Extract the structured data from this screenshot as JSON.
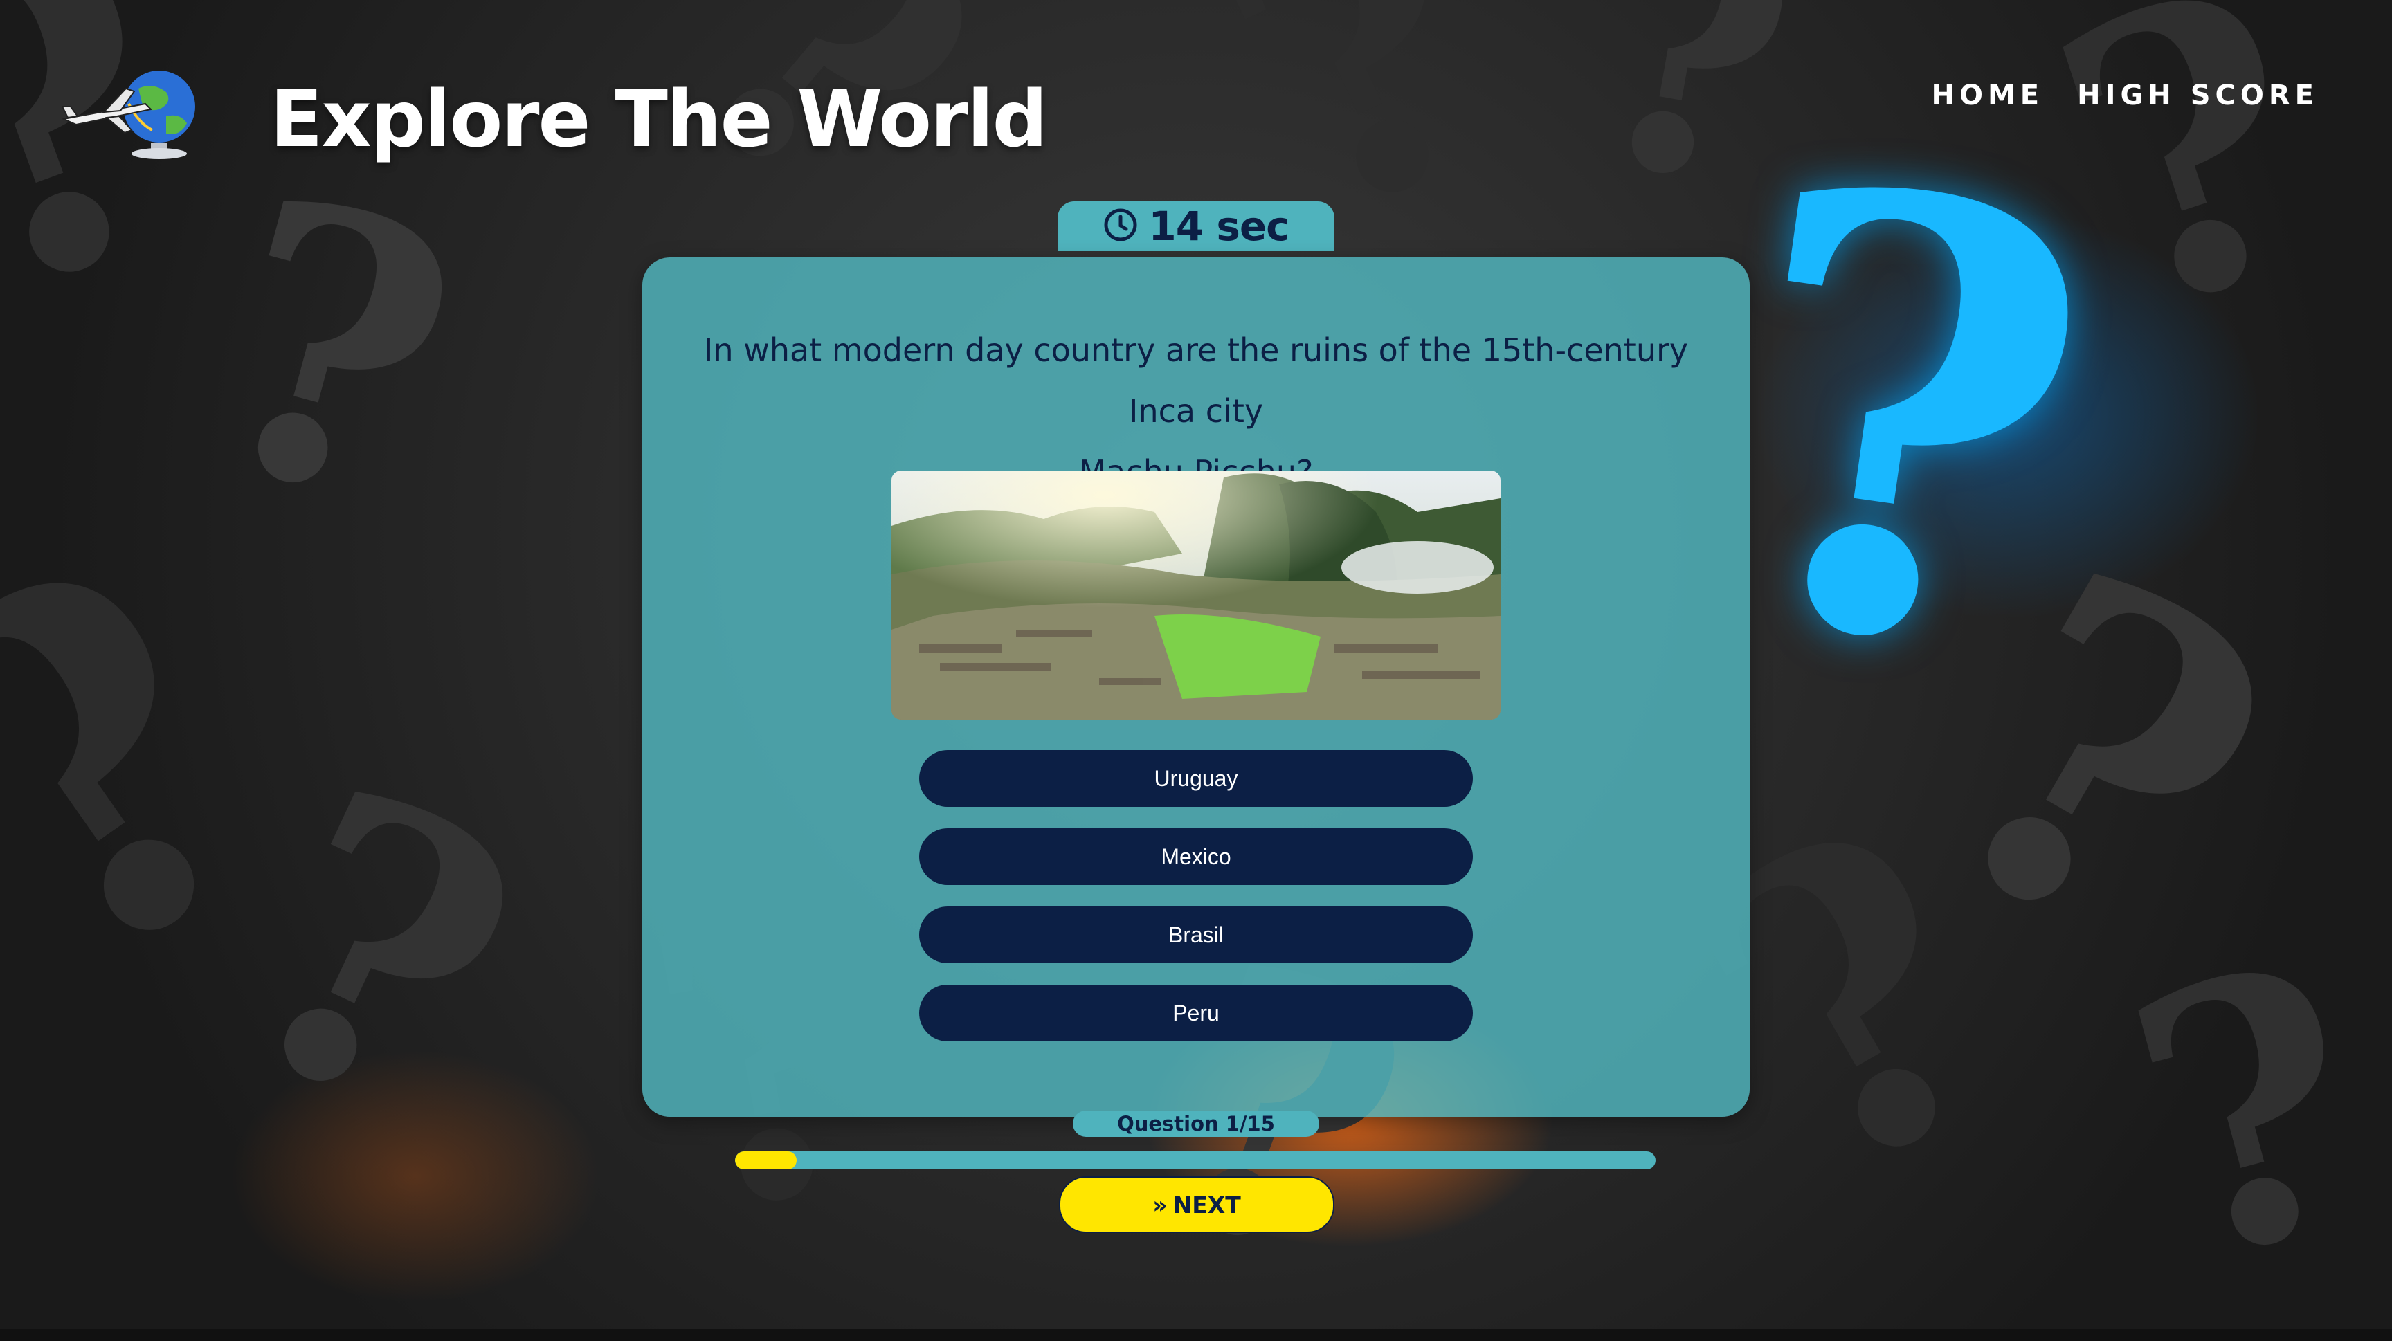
{
  "header": {
    "title": "Explore The World",
    "logo_icon": "globe-airplane-icon"
  },
  "nav": {
    "home": "HOME",
    "high_score": "HIGH SCORE"
  },
  "timer": {
    "icon": "clock-icon",
    "text": "14 sec"
  },
  "quiz": {
    "question_line1": "In what modern day country are the ruins of the 15th-century Inca city",
    "question_line2": "Machu Picchu?",
    "image_icon": "machu-picchu-photo",
    "answers": [
      "Uruguay",
      "Mexico",
      "Brasil",
      "Peru"
    ]
  },
  "progress": {
    "counter": "Question 1/15",
    "current": 1,
    "total": 15
  },
  "next": {
    "icon": "double-chevron-right-icon",
    "label": "NEXT"
  },
  "colors": {
    "navy": "#0c1f45",
    "teal": "#4fb3bd",
    "yellow": "#ffe600"
  }
}
